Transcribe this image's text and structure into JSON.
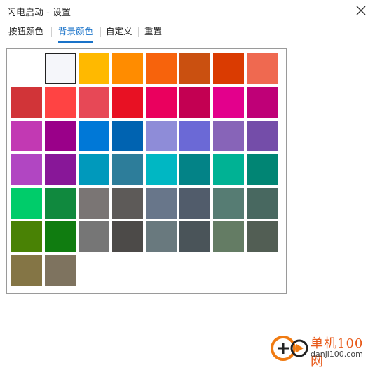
{
  "window": {
    "title": "闪电启动 - 设置"
  },
  "tabs": [
    {
      "label": "按钮颜色",
      "active": false
    },
    {
      "label": "背景颜色",
      "active": true
    },
    {
      "label": "自定义",
      "active": false
    },
    {
      "label": "重置",
      "active": false
    }
  ],
  "colors": {
    "accent": "#1a73c9",
    "swatches": [
      "#ffffff",
      "#f5f6fa",
      "#ffb900",
      "#ff8c00",
      "#f7630c",
      "#ca5010",
      "#da3b01",
      "#ef6950",
      "#d13438",
      "#ff4343",
      "#e74856",
      "#e81123",
      "#ea005e",
      "#c30052",
      "#e3008c",
      "#bf0077",
      "#c239b3",
      "#9a0089",
      "#0078d7",
      "#0063b1",
      "#8e8cd8",
      "#6b69d6",
      "#8764b8",
      "#744da9",
      "#b146c2",
      "#881798",
      "#0099bc",
      "#2d7d9a",
      "#00b7c3",
      "#038387",
      "#00b294",
      "#018574",
      "#00cc6a",
      "#10893e",
      "#7a7574",
      "#5d5a58",
      "#68768a",
      "#515c6b",
      "#567c73",
      "#486860",
      "#498205",
      "#107c10",
      "#767676",
      "#4c4a48",
      "#69797e",
      "#4a5459",
      "#647c64",
      "#525e54",
      "#847545",
      "#7e735f"
    ],
    "selected_index": 1
  },
  "watermark": {
    "name": "单机100网",
    "url": "danji100.com",
    "logo_icon": "plus-play-icon",
    "logo_color": "#f07b12"
  }
}
